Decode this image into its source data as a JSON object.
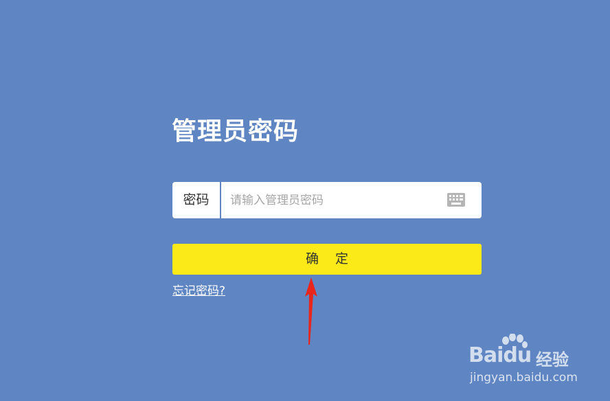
{
  "page": {
    "title": "管理员密码"
  },
  "password_field": {
    "label": "密码",
    "placeholder": "请输入管理员密码",
    "value": ""
  },
  "icons": {
    "keyboard": "keyboard-icon"
  },
  "confirm_button": {
    "label": "确定"
  },
  "forgot_link": {
    "label": "忘记密码?"
  },
  "watermark": {
    "brand": "Baidu",
    "product": "经验",
    "url": "jingyan.baidu.com"
  },
  "colors": {
    "background": "#5f85c2",
    "button": "#fbea17",
    "annotation_arrow": "#e8261b"
  }
}
